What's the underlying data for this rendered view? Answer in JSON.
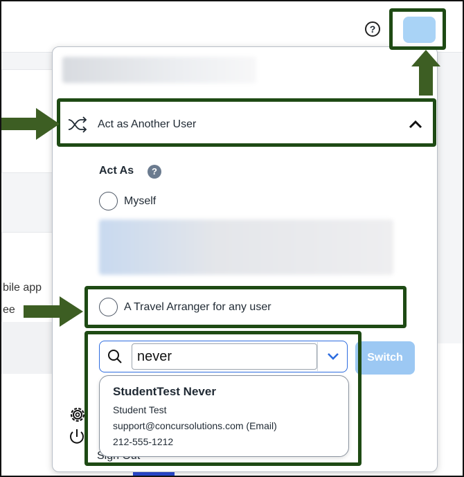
{
  "header": {
    "help_icon": "?",
    "help_icon_name": "help-circle-icon",
    "avatar_color": "#a9d3f6"
  },
  "background": {
    "text_line1": "bile app",
    "text_line2": "ee"
  },
  "panel": {
    "act_as_another_user_label": "Act as Another User",
    "act_as_title": "Act As",
    "act_as_help": "?",
    "options": [
      {
        "label": "Myself",
        "selected": false
      },
      {
        "label": "A Travel Arranger for any user",
        "selected": false
      }
    ],
    "search": {
      "value": "never"
    },
    "switch_label": "Switch",
    "result": {
      "name": "StudentTest Never",
      "subtitle": "Student Test",
      "email": "support@concursolutions.com (Email)",
      "phone": "212-555-1212"
    },
    "signout_label": "Sign Out"
  },
  "colors": {
    "annotation": "#1e4a14",
    "accent": "#2d6cdf",
    "switch_disabled": "#9cc8f3"
  }
}
